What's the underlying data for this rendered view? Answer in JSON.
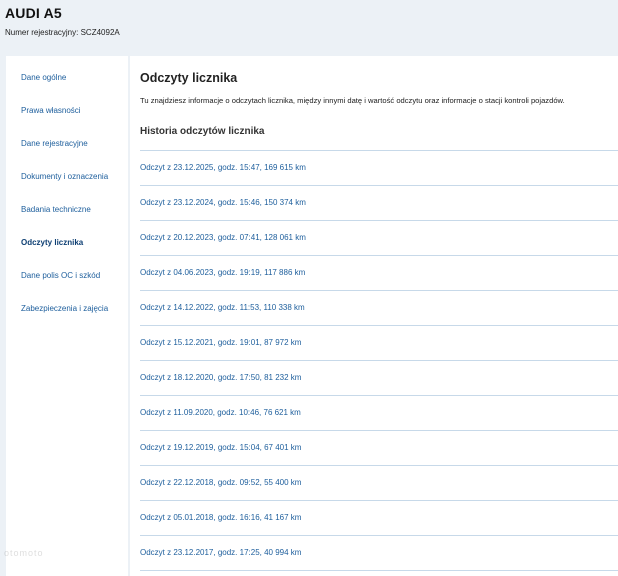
{
  "header": {
    "title": "AUDI A5",
    "registration_label": "Numer rejestracyjny:",
    "registration_value": "SCZ4092A"
  },
  "sidebar": {
    "items": [
      {
        "label": "Dane ogólne"
      },
      {
        "label": "Prawa własności"
      },
      {
        "label": "Dane rejestracyjne"
      },
      {
        "label": "Dokumenty i oznaczenia"
      },
      {
        "label": "Badania techniczne"
      },
      {
        "label": "Odczyty licznika",
        "active": true
      },
      {
        "label": "Dane polis OC i szkód"
      },
      {
        "label": "Zabezpieczenia i zajęcia"
      }
    ]
  },
  "main": {
    "title": "Odczyty licznika",
    "description": "Tu znajdziesz informacje o odczytach licznika, między innymi datę i wartość odczytu oraz informacje o stacji kontroli pojazdów.",
    "section_title": "Historia odczytów licznika",
    "readings": [
      "Odczyt z 23.12.2025, godz. 15:47, 169 615 km",
      "Odczyt z 23.12.2024, godz. 15:46, 150 374 km",
      "Odczyt z 20.12.2023, godz. 07:41, 128 061 km",
      "Odczyt z 04.06.2023, godz. 19:19, 117 886 km",
      "Odczyt z 14.12.2022, godz. 11:53, 110 338 km",
      "Odczyt z 15.12.2021, godz. 19:01, 87 972 km",
      "Odczyt z 18.12.2020, godz. 17:50, 81 232 km",
      "Odczyt z 11.09.2020, godz. 10:46, 76 621 km",
      "Odczyt z 19.12.2019, godz. 15:04, 67 401 km",
      "Odczyt z 22.12.2018, godz. 09:52, 55 400 km",
      "Odczyt z 05.01.2018, godz. 16:16, 41 167 km",
      "Odczyt z 23.12.2017, godz. 17:25, 40 994 km"
    ]
  },
  "watermark": "otomoto"
}
